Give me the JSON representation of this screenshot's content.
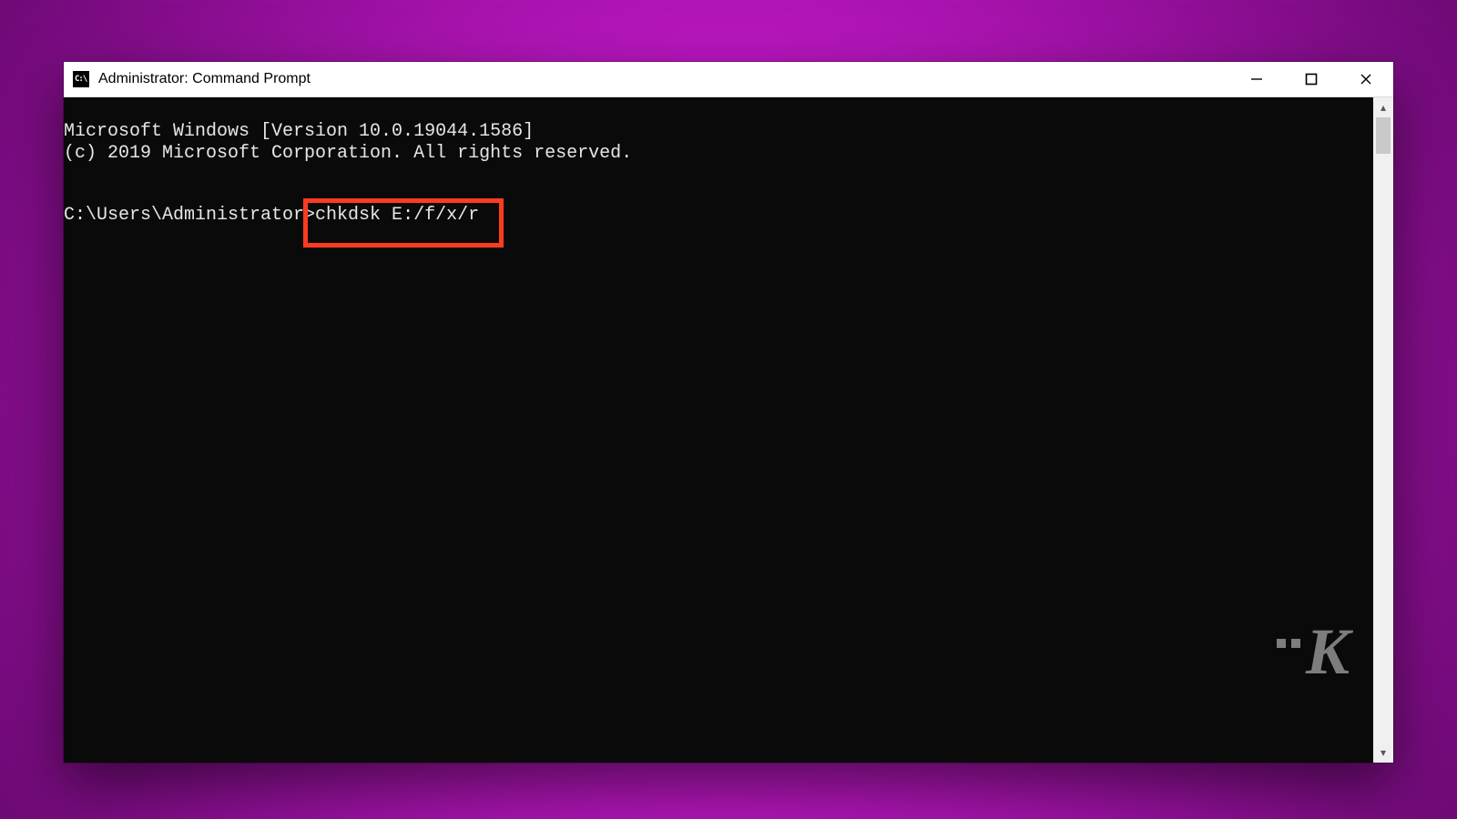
{
  "window": {
    "title": "Administrator: Command Prompt",
    "app_icon_label": "C:\\"
  },
  "console": {
    "line1": "Microsoft Windows [Version 10.0.19044.1586]",
    "line2": "(c) 2019 Microsoft Corporation. All rights reserved.",
    "prompt_prefix": "C:\\Users\\Administrator>",
    "command": "chkdsk E:/f/x/r"
  },
  "watermark": {
    "letter": "K"
  },
  "highlight": {
    "color": "#ff3b1f"
  }
}
